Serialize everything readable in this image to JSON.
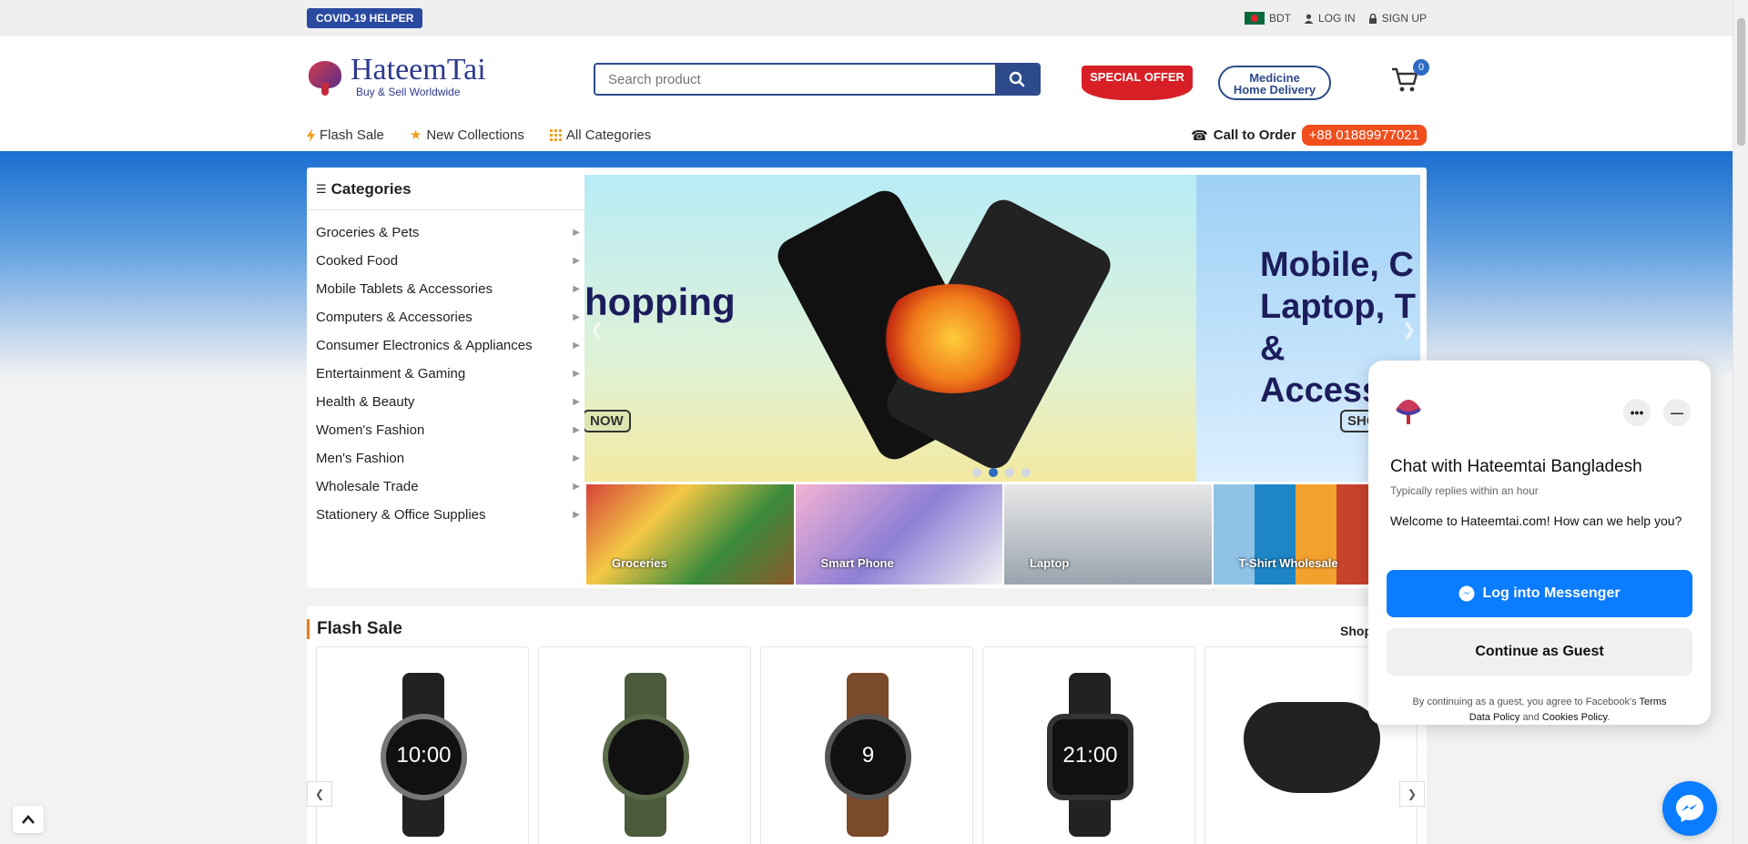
{
  "topbar": {
    "covid_label": "COVID-19 HELPER",
    "currency": "BDT",
    "login": "LOG IN",
    "signup": "SIGN UP"
  },
  "header": {
    "brand_name": "HateemTai",
    "brand_tagline": "Buy & Sell Worldwide",
    "search_placeholder": "Search product",
    "special_offer": "SPECIAL OFFER",
    "medicine_line1": "Medicine",
    "medicine_line2": "Home Delivery",
    "cart_count": "0"
  },
  "nav": {
    "items": [
      "Flash Sale",
      "New Collections",
      "All Categories"
    ],
    "call_label": "Call to Order",
    "phone": "+88 01889977021"
  },
  "categories": {
    "title": "Categories",
    "items": [
      "Groceries & Pets",
      "Cooked Food",
      "Mobile Tablets & Accessories",
      "Computers & Accessories",
      "Consumer Electronics & Appliances",
      "Entertainment & Gaming",
      "Health & Beauty",
      "Women's Fashion",
      "Men's Fashion",
      "Wholesale Trade",
      "Stationery & Office Supplies"
    ]
  },
  "slider": {
    "left_text": "hopping",
    "left_button": "NOW",
    "right_text": [
      "Mobile, C",
      "Laptop, T",
      "& Accesso"
    ],
    "right_button": "SHO",
    "dot_count": 4,
    "active_dot": 1
  },
  "thumbs": [
    "Groceries",
    "Smart Phone",
    "Laptop",
    "T-Shirt Wholesale"
  ],
  "flash_sale": {
    "title": "Flash Sale",
    "shop_all": "Shop",
    "product_watch_time": "10:00",
    "product_watch4_time": "21:00",
    "product_watch3_num": "9"
  },
  "chat": {
    "title": "Chat with Hateemtai Bangladesh",
    "subtitle": "Typically replies within an hour",
    "welcome": "Welcome to Hateemtai.com! How can we help you?",
    "login_button": "Log into Messenger",
    "guest_button": "Continue as Guest",
    "legal_prefix": "By continuing as a guest, you agree to Facebook's",
    "legal_terms": "Terms",
    "legal_data": "Data Policy",
    "legal_and": "and",
    "legal_cookies": "Cookies Policy",
    "more_label": "•••",
    "minimize_label": "—"
  },
  "colors": {
    "brand_blue": "#2d4a8a",
    "accent_orange": "#f04e1d",
    "messenger_blue": "#0a7cff"
  }
}
